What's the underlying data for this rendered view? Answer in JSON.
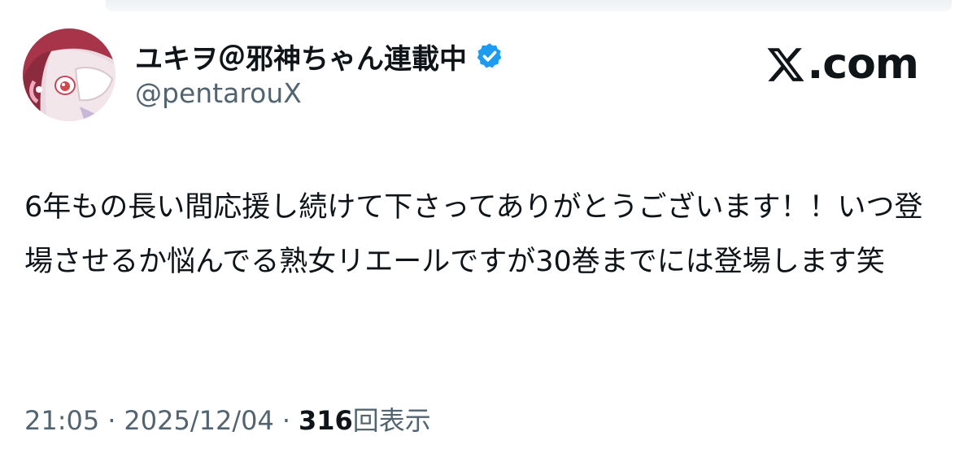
{
  "author": {
    "display_name": "ユキヲ＠邪神ちゃん連載中",
    "handle": "@pentarouX",
    "verified": true,
    "verified_color": "#1d9bf0"
  },
  "site": {
    "icon": "x-logo-icon",
    "label": ".com"
  },
  "tweet": {
    "text": "6年もの長い間応援し続けて下さってありがとうございます！！いつ登場させるか悩んでる熟女リエールですが30巻までには登場します笑"
  },
  "meta": {
    "time": "21:05",
    "separator": "·",
    "date": "2025/12/04",
    "views_count": "316",
    "views_label": "回表示"
  },
  "colors": {
    "text": "#0f1419",
    "secondary": "#536471",
    "background": "#ffffff"
  }
}
